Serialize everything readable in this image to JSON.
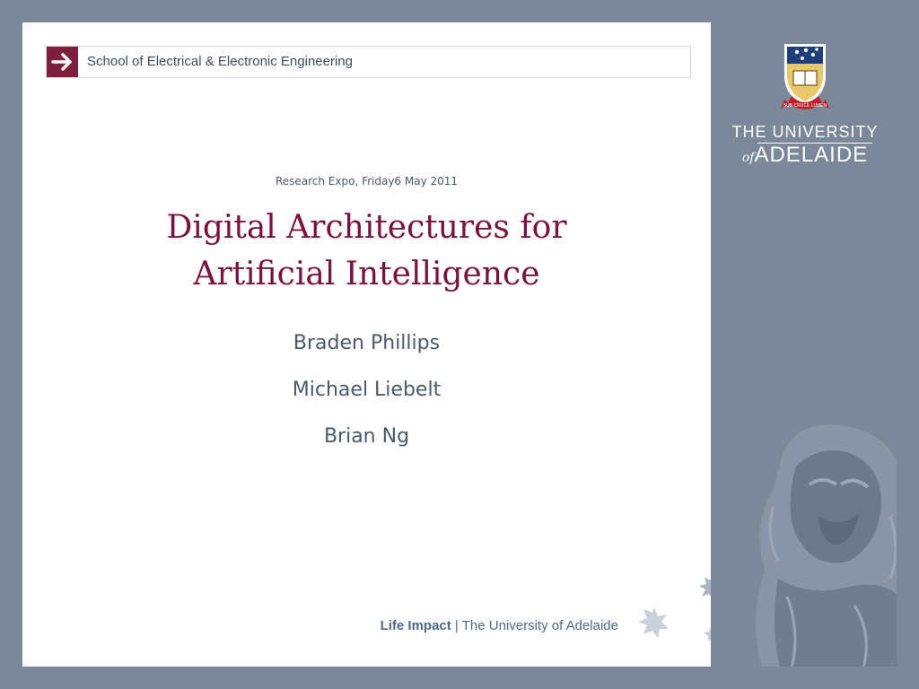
{
  "header": {
    "school": "School of Electrical & Electronic Engineering",
    "arrow_icon": "right-arrow-icon"
  },
  "slide": {
    "event": "Research Expo, Friday6 May 2011",
    "title_line1": "Digital Architectures for",
    "title_line2": "Artificial Intelligence",
    "authors": [
      "Braden Phillips",
      "Michael Liebelt",
      "Brian Ng"
    ]
  },
  "footer": {
    "tagline": "Life Impact",
    "separator": " | ",
    "institution": "The University of Adelaide"
  },
  "branding": {
    "line1": "THE UNIVERSITY",
    "line2_of": "of",
    "line2_name": "ADELAIDE",
    "crest_motto": "SUB CRUCE LUMEN",
    "crest_icon": "university-crest-icon",
    "lion_icon": "lion-watermark-icon",
    "star_icon": "star-cluster-icon"
  },
  "colors": {
    "accent": "#7e1f3c",
    "title": "#7a1240",
    "panel": "#7a8899",
    "text": "#4a5a6a"
  }
}
